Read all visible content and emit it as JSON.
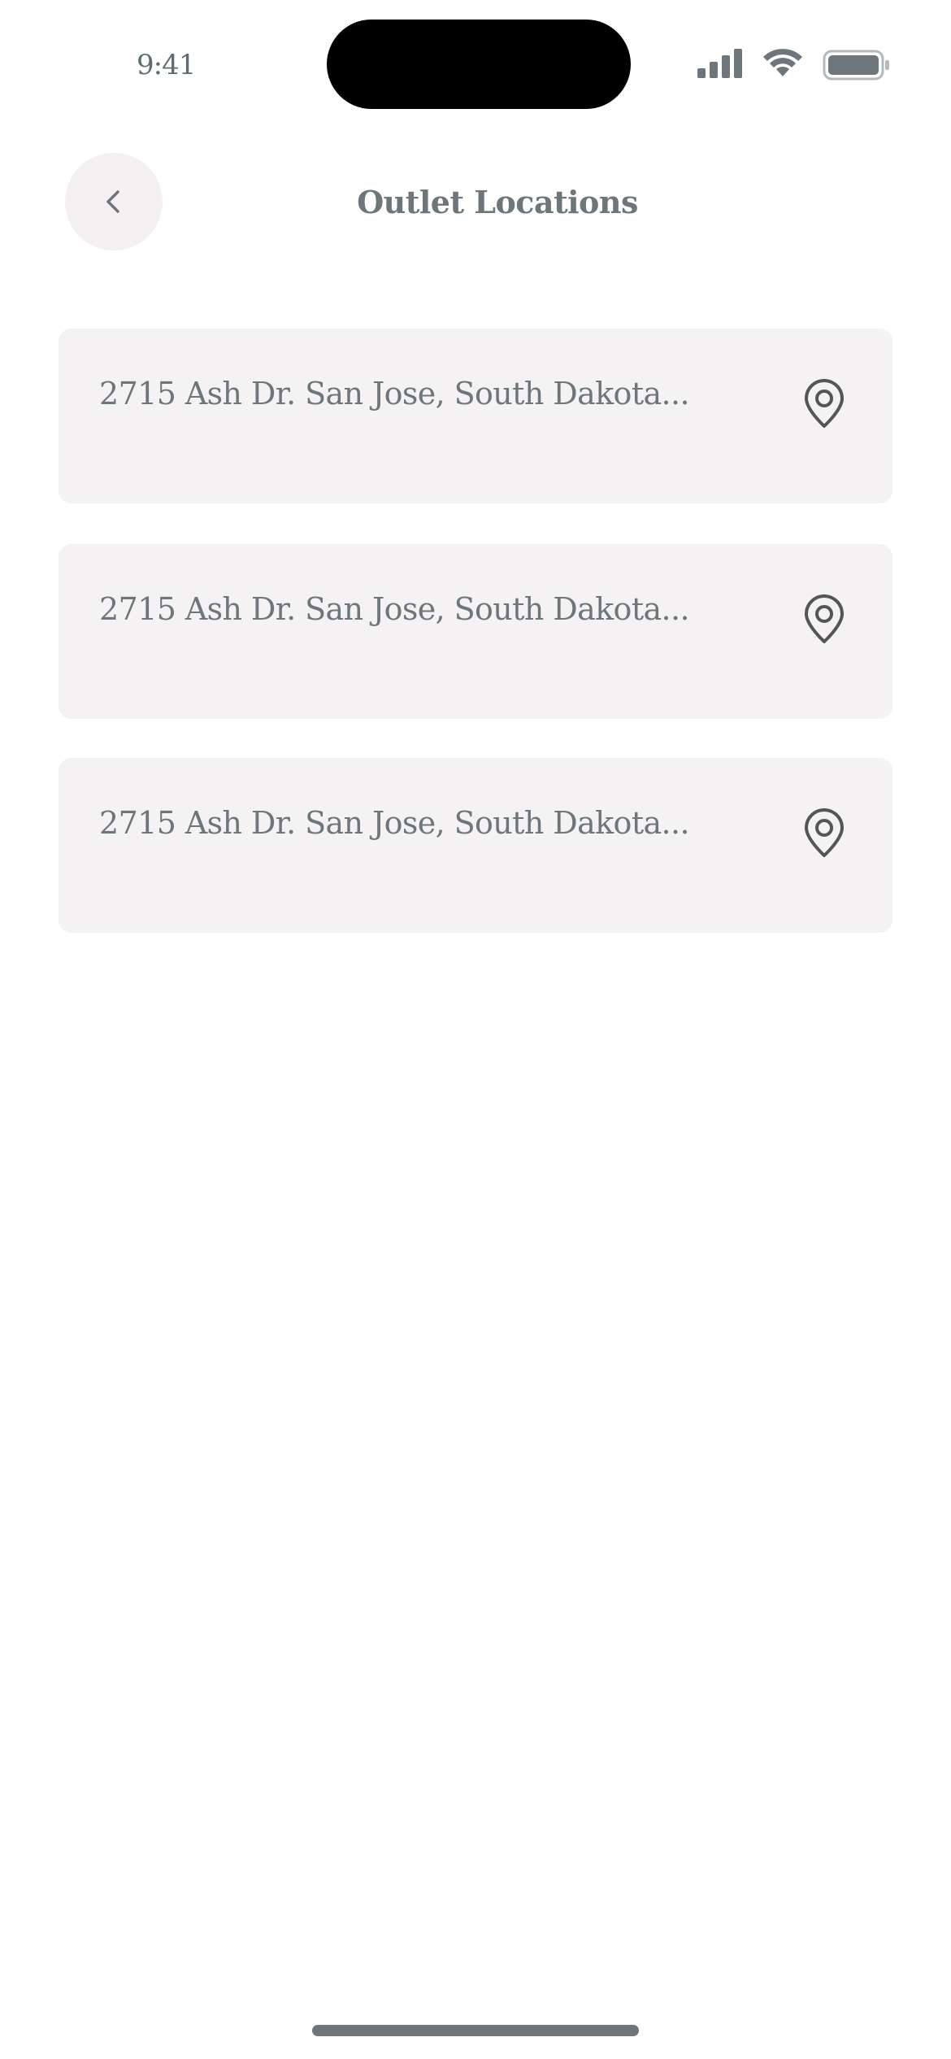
{
  "status_bar": {
    "time": "9:41",
    "icon_color": "#6d777b"
  },
  "header": {
    "title": "Outlet Locations",
    "back_icon": "chevron-left-icon"
  },
  "locations": [
    {
      "address": "2715 Ash Dr. San Jose, South Dakota...",
      "icon": "map-pin-icon"
    },
    {
      "address": "2715 Ash Dr. San Jose, South Dakota...",
      "icon": "map-pin-icon"
    },
    {
      "address": "2715 Ash Dr. San Jose, South Dakota...",
      "icon": "map-pin-icon"
    }
  ],
  "colors": {
    "card_background": "#f5f2f3",
    "text": "#6d777b",
    "icon": "#555555"
  }
}
